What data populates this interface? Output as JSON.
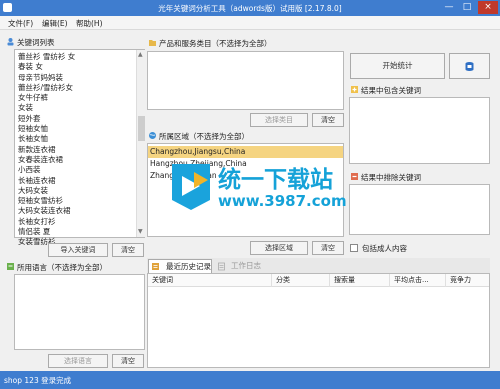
{
  "window": {
    "title": "光年关键词分析工具（adwords版）试用版 [2.17.8.0]",
    "min_glyph": "—",
    "max_glyph": "□",
    "close_glyph": "×"
  },
  "menu": [
    {
      "label": "文件(F)"
    },
    {
      "label": "编辑(E)"
    },
    {
      "label": "帮助(H)"
    }
  ],
  "keywords": {
    "header": "关键词列表",
    "items": [
      "蕾丝衫 雪纺衫 女",
      "春装 女",
      "母亲节妈妈装",
      "蕾丝衫/雪纺衫女",
      "女牛仔裤",
      "女装",
      "短外套",
      "短袖女恤",
      "长袖女恤",
      "新款连衣裙",
      "女春装连衣裙",
      "小西装",
      "长袖连衣裙",
      "大码女装",
      "短袖女雪纺衫",
      "大码女装连衣裙",
      "长袖女打衫",
      "情侣装 夏",
      "女装雪纺衫"
    ],
    "import_label": "导入关键词",
    "clear_label": "清空"
  },
  "languages": {
    "header": "所用语言（不选择为全部）",
    "select_label": "选择语言",
    "clear_label": "清空"
  },
  "categories": {
    "header": "产品和服务类目（不选择为全部）",
    "select_label": "选择类目",
    "clear_label": "清空"
  },
  "regions": {
    "header": "所属区域（不选择为全部）",
    "items": [
      {
        "label": "Changzhou,Jiangsu,China"
      },
      {
        "label": "Hangzhou,Zhejiang,China"
      },
      {
        "label": "Zhangzhou,Fujian"
      }
    ],
    "select_label": "选择区域",
    "clear_label": "清空"
  },
  "actions": {
    "start_label": "开始统计"
  },
  "include": {
    "header": "结果中包含关键词"
  },
  "exclude": {
    "header": "结果中排除关键词"
  },
  "adult": {
    "label": "包括成人内容"
  },
  "tabs": [
    {
      "label": "最近历史记录"
    },
    {
      "label": "工作日志"
    }
  ],
  "table": {
    "columns": [
      "关键词",
      "分类",
      "搜索量",
      "平均点击...",
      "竞争力"
    ]
  },
  "status": {
    "text": "shop 123 登录完成"
  },
  "watermark": {
    "brand": "统一下载站",
    "url": "www.3987.com"
  },
  "colors": {
    "titlebar": "#3f7dcf",
    "selection": "#f5d481",
    "watermark": "#15a2d8"
  }
}
